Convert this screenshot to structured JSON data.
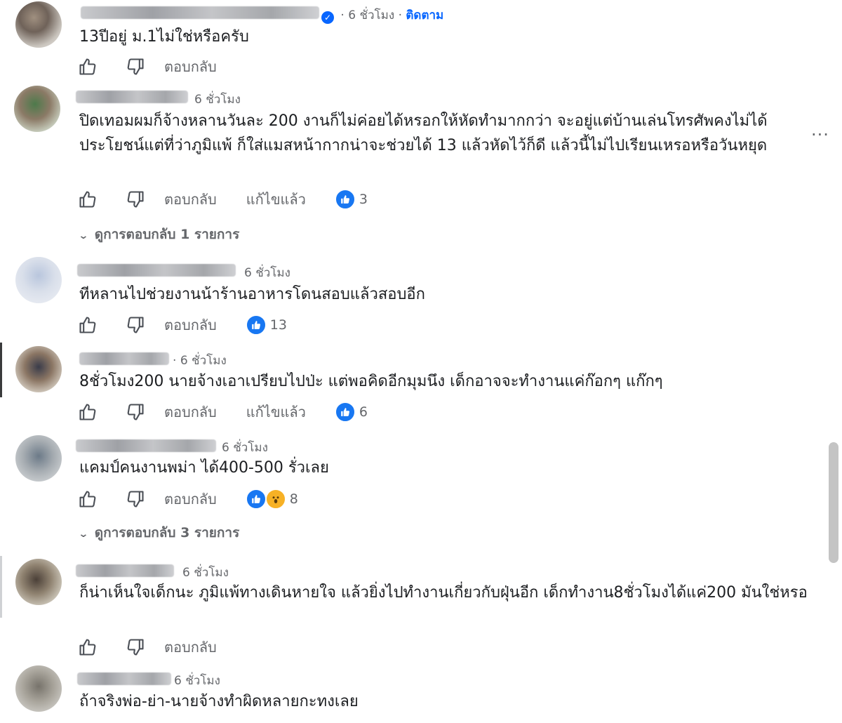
{
  "comments": [
    {
      "time": "6 ชั่วโมง",
      "follow": "ติดตาม",
      "text": "13ปีอยู่ ม.1ไม่ใช่หรือครับ",
      "reply": "ตอบกลับ"
    },
    {
      "time": "6 ชั่วโมง",
      "text": "ปิดเทอมผมก็จ้างหลานวันละ 200 งานก็ไม่ค่อยได้หรอกให้หัดทำมากกว่า จะอยู่แต่บ้านเล่นโทรศัพคงไม่ได้ประโยชน์แต่ที่ว่าภูมิแพ้ ก็ใส่แมสหน้ากากน่าจะช่วยได้ 13 แล้วหัดไว้ก็ดี แล้วนี้ไม่ไปเรียนเหรอหรือวันหยุด",
      "reply": "ตอบกลับ",
      "edited": "แก้ไขแล้ว",
      "reaction_count": "3",
      "view_replies": "ดูการตอบกลับ 1 รายการ"
    },
    {
      "time": "6 ชั่วโมง",
      "text": "ทีหลานไปช่วยงานน้าร้านอาหารโดนสอบแล้วสอบอีก",
      "reply": "ตอบกลับ",
      "reaction_count": "13"
    },
    {
      "time": "6 ชั่วโมง",
      "text": "8ชั่วโมง200 นายจ้างเอาเปรียบไปป่ะ แต่พอคิดอีกมุมนึง เด็กอาจจะทำงานแค่ก๊อกๆ แก๊กๆ",
      "reply": "ตอบกลับ",
      "edited": "แก้ไขแล้ว",
      "reaction_count": "6"
    },
    {
      "time": "6 ชั่วโมง",
      "text": "แคมป์คนงานพม่า ได้400-500 รั่วเลย",
      "reply": "ตอบกลับ",
      "reaction_count": "8",
      "view_replies": "ดูการตอบกลับ 3 รายการ"
    },
    {
      "time": "6 ชั่วโมง",
      "text": "ก็น่าเห็นใจเด็กนะ ภูมิแพ้ทางเดินหายใจ แล้วยิ่งไปทำงานเกี่ยวกับฝุ่นอีก เด็กทำงาน8ชั่วโมงได้แค่200 มันใช่หรอ",
      "reply": "ตอบกลับ"
    },
    {
      "time": "6 ชั่วโมง",
      "text": "ถ้าจริงพ่อ-ย่า-นายจ้างทำผิดหลายกะทงเลย"
    }
  ],
  "more_options": "···",
  "icons": {
    "like": "thumbs-up-icon",
    "dislike": "thumbs-down-icon",
    "like_reaction": "like-reaction-icon",
    "wow_reaction": "wow-reaction-icon",
    "verified": "verified-badge-icon",
    "chevron": "chevron-down-icon"
  },
  "colors": {
    "link_blue": "#0866ff",
    "like_blue": "#1877f2",
    "wow_yellow": "#f7b125",
    "meta_gray": "#65676b"
  }
}
